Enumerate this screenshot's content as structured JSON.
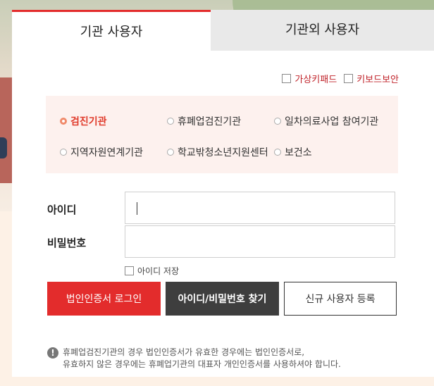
{
  "tabs": [
    {
      "label": "기관 사용자",
      "active": true
    },
    {
      "label": "기관외 사용자",
      "active": false
    }
  ],
  "keyboard_options": {
    "virtual_keypad": "가상키패드",
    "keyboard_security": "키보드보안"
  },
  "org_types": [
    {
      "label": "검진기관",
      "selected": true
    },
    {
      "label": "휴폐업검진기관",
      "selected": false
    },
    {
      "label": "일차의료사업 참여기관",
      "selected": false
    },
    {
      "label": "지역자원연계기관",
      "selected": false
    },
    {
      "label": "학교밖청소년지원센터",
      "selected": false
    },
    {
      "label": "보건소",
      "selected": false
    }
  ],
  "form": {
    "id_label": "아이디",
    "password_label": "비밀번호",
    "save_id_label": "아이디 저장"
  },
  "buttons": {
    "cert_login": "법인인증서 로그인",
    "find_account": "아이디/비밀번호 찾기",
    "register": "신규 사용자 등록"
  },
  "notice": {
    "icon": "!",
    "line1": "휴폐업검진기관의 경우 법인인증서가 유효한 경우에는 법인인증서로,",
    "line2": "유효하지 않은 경우에는 휴폐업기관의 대표자 개인인증서를 사용하셔야 합니다."
  },
  "colors": {
    "accent": "#e32c2c",
    "dark_button": "#3e3e3e",
    "selected_radio": "#e03a2a"
  }
}
